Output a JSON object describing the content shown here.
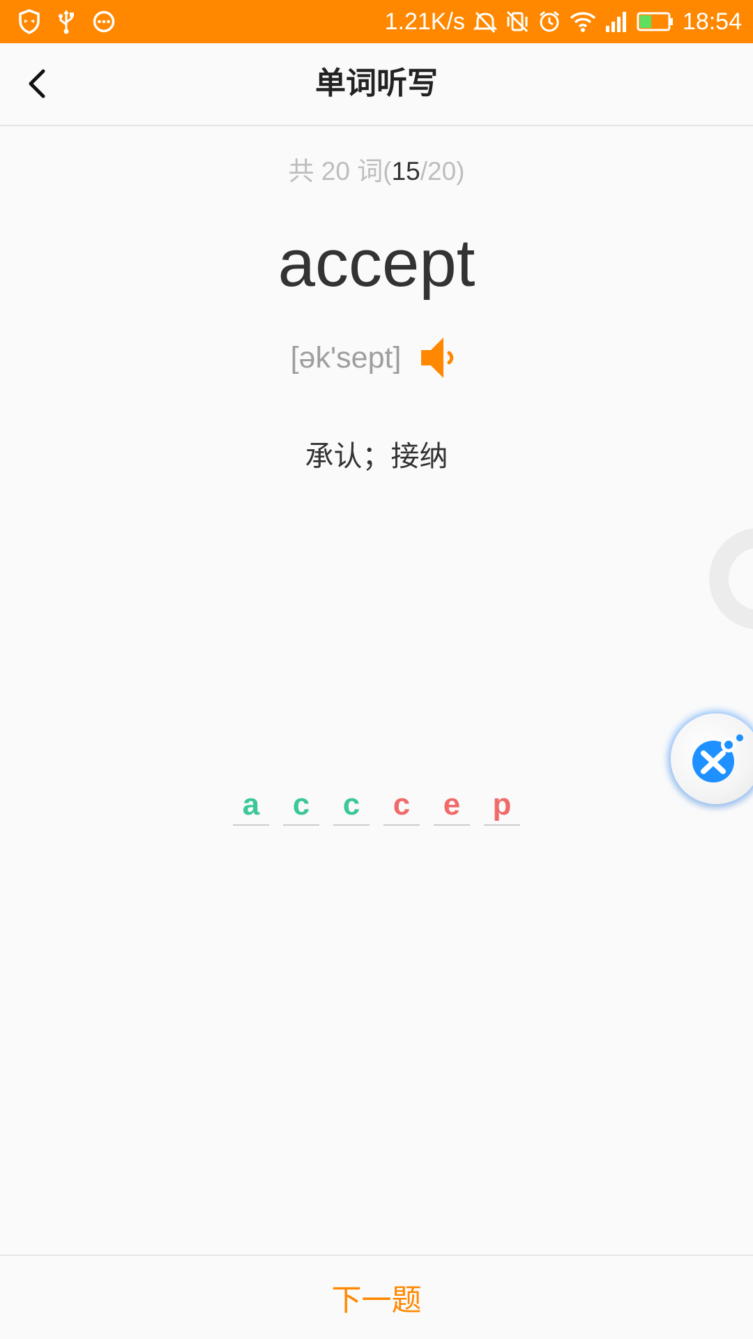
{
  "status_bar": {
    "net_speed": "1.21K/s",
    "time": "18:54",
    "left_icons": [
      "shield-icon",
      "usb-icon",
      "chat-bubble-icon"
    ],
    "right_icons": [
      "mute-icon",
      "vibrate-off-icon",
      "alarm-icon",
      "wifi-icon",
      "signal-icon",
      "battery-icon"
    ]
  },
  "app_bar": {
    "title": "单词听写",
    "back_icon": "chevron-left-icon"
  },
  "progress": {
    "prefix": "共 20 词(",
    "current": "15",
    "suffix": "/20)"
  },
  "word": {
    "text": "accept",
    "phonetic": "[ək'sept]",
    "meaning": "承认；接纳"
  },
  "answer_letters": [
    {
      "char": "a",
      "status": "correct"
    },
    {
      "char": "c",
      "status": "correct"
    },
    {
      "char": "c",
      "status": "correct"
    },
    {
      "char": "c",
      "status": "wrong"
    },
    {
      "char": "e",
      "status": "wrong"
    },
    {
      "char": "p",
      "status": "wrong"
    }
  ],
  "bottom_bar": {
    "next_label": "下一题"
  },
  "colors": {
    "brand": "#ff8800",
    "correct": "#3cc79a",
    "wrong": "#f06a6a",
    "assistant": "#1e90ff"
  }
}
